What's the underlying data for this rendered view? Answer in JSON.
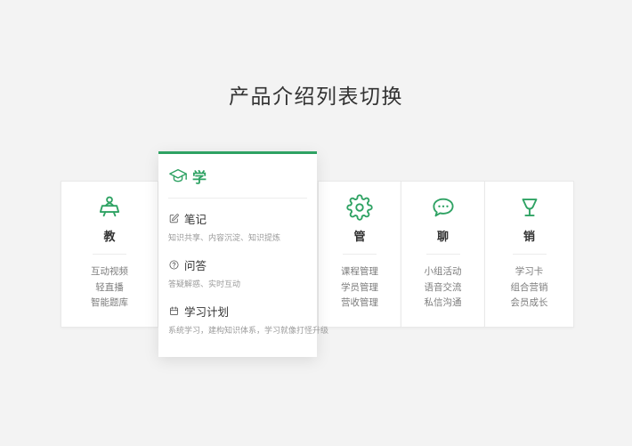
{
  "page": {
    "title": "产品介绍列表切换"
  },
  "colors": {
    "accent": "#2ea263",
    "background": "#f3f3f3",
    "card_bg": "#ffffff",
    "text_dark": "#333333",
    "text_muted": "#7d7d7d",
    "text_desc": "#9b9b9b"
  },
  "cards": {
    "teach": {
      "title": "教",
      "icon": "lecturer-icon",
      "items": [
        "互动视频",
        "轻直播",
        "智能题库"
      ]
    },
    "manage": {
      "title": "管",
      "icon": "gear-icon",
      "items": [
        "课程管理",
        "学员管理",
        "营收管理"
      ]
    },
    "chat": {
      "title": "聊",
      "icon": "chat-bubble-icon",
      "items": [
        "小组活动",
        "语音交流",
        "私信沟通"
      ]
    },
    "sales": {
      "title": "销",
      "icon": "trophy-icon",
      "items": [
        "学习卡",
        "组合营销",
        "会员成长"
      ]
    }
  },
  "expanded_card": {
    "title": "学",
    "icon": "graduation-cap-icon",
    "sections": [
      {
        "icon": "note-edit-icon",
        "title": "笔记",
        "desc": "知识共享、内容沉淀、知识提炼"
      },
      {
        "icon": "question-circle-icon",
        "title": "问答",
        "desc": "答疑解惑、实时互动"
      },
      {
        "icon": "plan-calendar-icon",
        "title": "学习计划",
        "desc": "系统学习，建构知识体系，学习就像打怪升级"
      }
    ]
  }
}
